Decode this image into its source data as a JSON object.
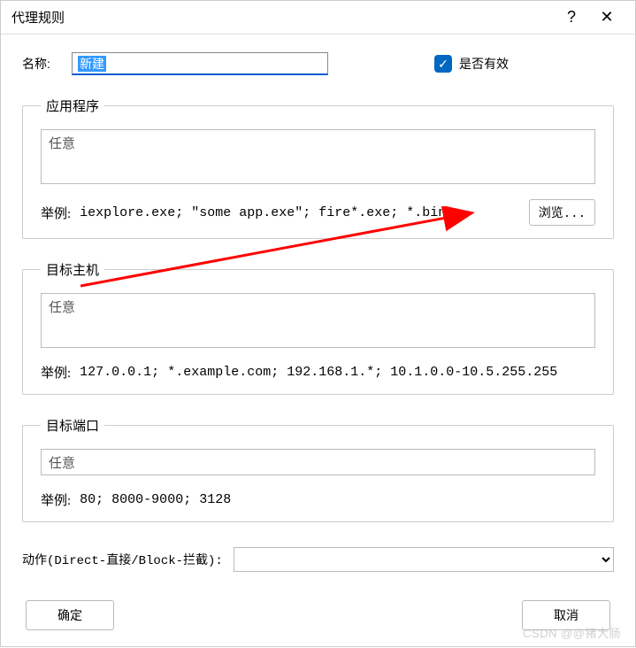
{
  "titlebar": {
    "title": "代理规则",
    "help": "?",
    "close": "✕"
  },
  "nameRow": {
    "label": "名称:",
    "value": "新建"
  },
  "effective": {
    "label": "是否有效",
    "checked": true
  },
  "app": {
    "legend": "应用程序",
    "textarea": "任意",
    "exampleLabel": "举例:",
    "exampleText": "iexplore.exe; \"some app.exe\"; fire*.exe; *.bin",
    "browse": "浏览..."
  },
  "host": {
    "legend": "目标主机",
    "textarea": "任意",
    "exampleLabel": "举例:",
    "exampleText": "127.0.0.1; *.example.com; 192.168.1.*; 10.1.0.0-10.5.255.255"
  },
  "port": {
    "legend": "目标端口",
    "textarea": "任意",
    "exampleLabel": "举例:",
    "exampleText": "80; 8000-9000; 3128"
  },
  "actionRow": {
    "label": "动作(Direct-直接/Block-拦截):"
  },
  "footer": {
    "ok": "确定",
    "cancel": "取消"
  },
  "watermark": "CSDN @@猪大肠"
}
